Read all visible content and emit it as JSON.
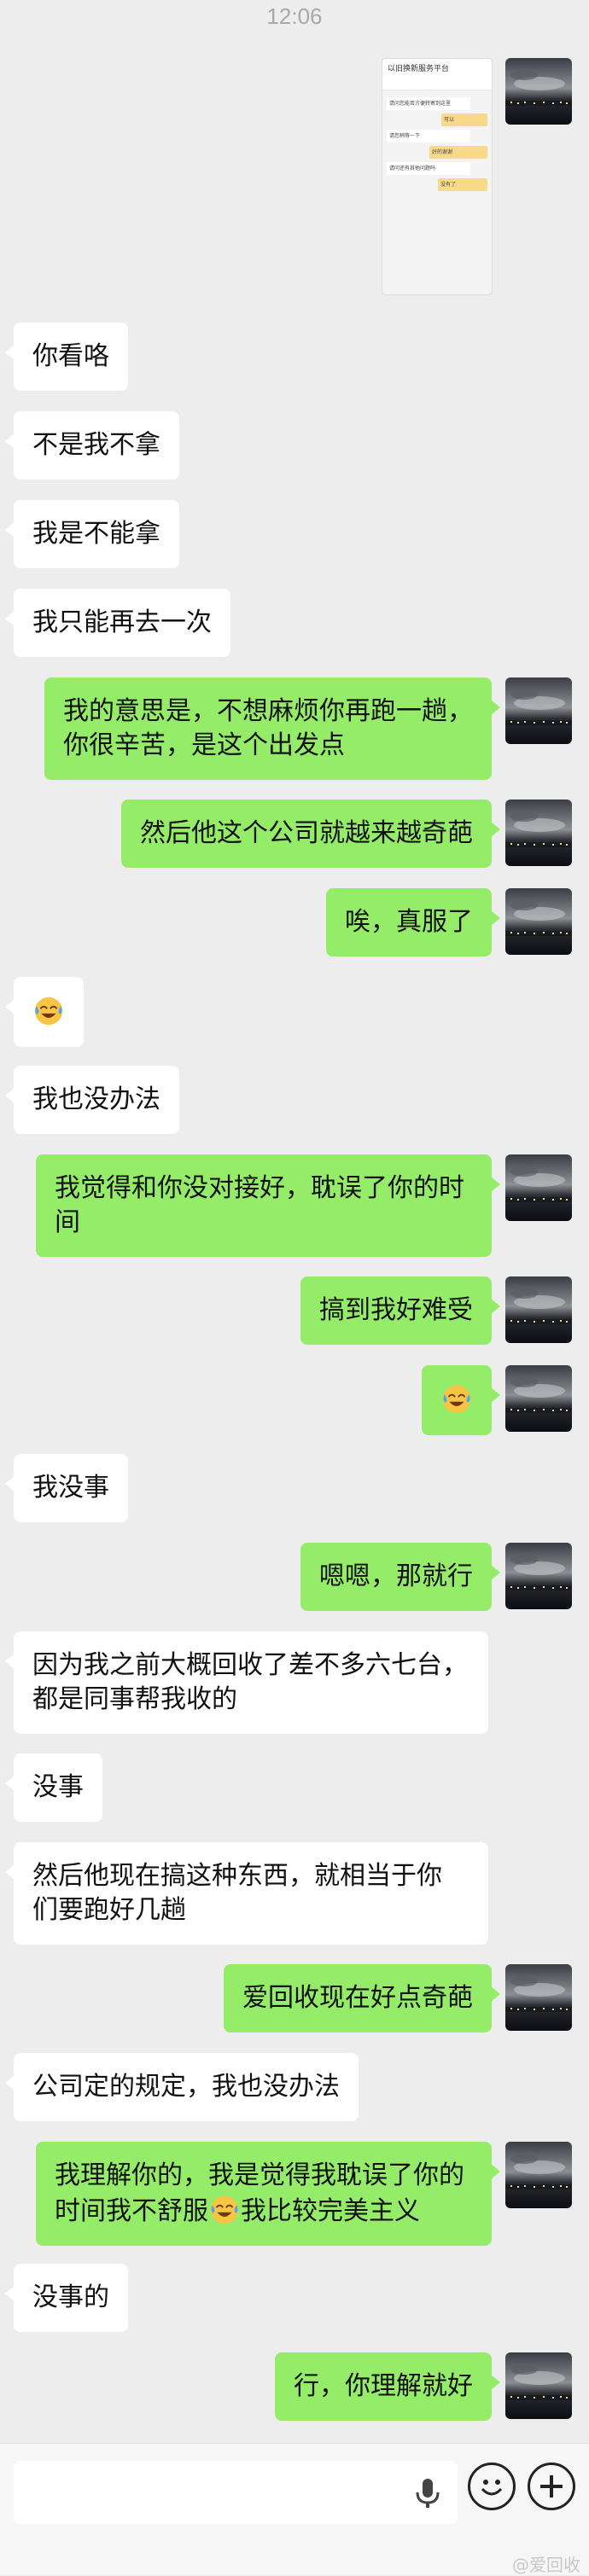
{
  "status": {
    "time": "12:06"
  },
  "screenshot_thumb": {
    "title": "以旧换新服务平台",
    "rows": [
      {
        "side": "in",
        "text": "请问您能否方便转寄到这里"
      },
      {
        "side": "out",
        "text": "可以"
      },
      {
        "side": "in",
        "text": "请您稍等一下"
      },
      {
        "side": "out",
        "text": "好的谢谢"
      },
      {
        "side": "in",
        "text": "请问还有其他问题吗"
      },
      {
        "side": "out",
        "text": "没有了"
      }
    ]
  },
  "messages": [
    {
      "side": "in",
      "text": "你看咯"
    },
    {
      "side": "in",
      "text": "不是我不拿"
    },
    {
      "side": "in",
      "text": "我是不能拿"
    },
    {
      "side": "in",
      "text": "我只能再去一次"
    },
    {
      "side": "out",
      "lines": [
        "我的意思是，不想麻烦你再跑一趟，",
        "你很辛苦，是这个出发点"
      ]
    },
    {
      "side": "out",
      "text": "然后他这个公司就越来越奇葩"
    },
    {
      "side": "out",
      "text": "唉，真服了"
    },
    {
      "side": "in",
      "emoji": "laugh-cry-emoji"
    },
    {
      "side": "in",
      "text": "我也没办法"
    },
    {
      "side": "out",
      "lines": [
        "我觉得和你没对接好，耽误了你的时",
        "间"
      ]
    },
    {
      "side": "out",
      "text": "搞到我好难受"
    },
    {
      "side": "out",
      "emoji": "laugh-cry-emoji"
    },
    {
      "side": "in",
      "text": "我没事"
    },
    {
      "side": "out",
      "text": "嗯嗯，那就行"
    },
    {
      "side": "in",
      "lines": [
        "因为我之前大概回收了差不多六七台，",
        "都是同事帮我收的"
      ]
    },
    {
      "side": "in",
      "text": "没事"
    },
    {
      "side": "in",
      "lines": [
        "然后他现在搞这种东西，就相当于你",
        "们要跑好几趟"
      ]
    },
    {
      "side": "out",
      "text": "爱回收现在好点奇葩"
    },
    {
      "side": "in",
      "text": "公司定的规定，我也没办法"
    },
    {
      "side": "out",
      "line1": "我理解你的，我是觉得我耽误了你的",
      "line2_a": "时间我不舒服",
      "line2_b": "我比较完美主义"
    },
    {
      "side": "in",
      "text": "没事的"
    },
    {
      "side": "out",
      "text": "行，你理解就好"
    }
  ],
  "watermark": "@爱回收"
}
